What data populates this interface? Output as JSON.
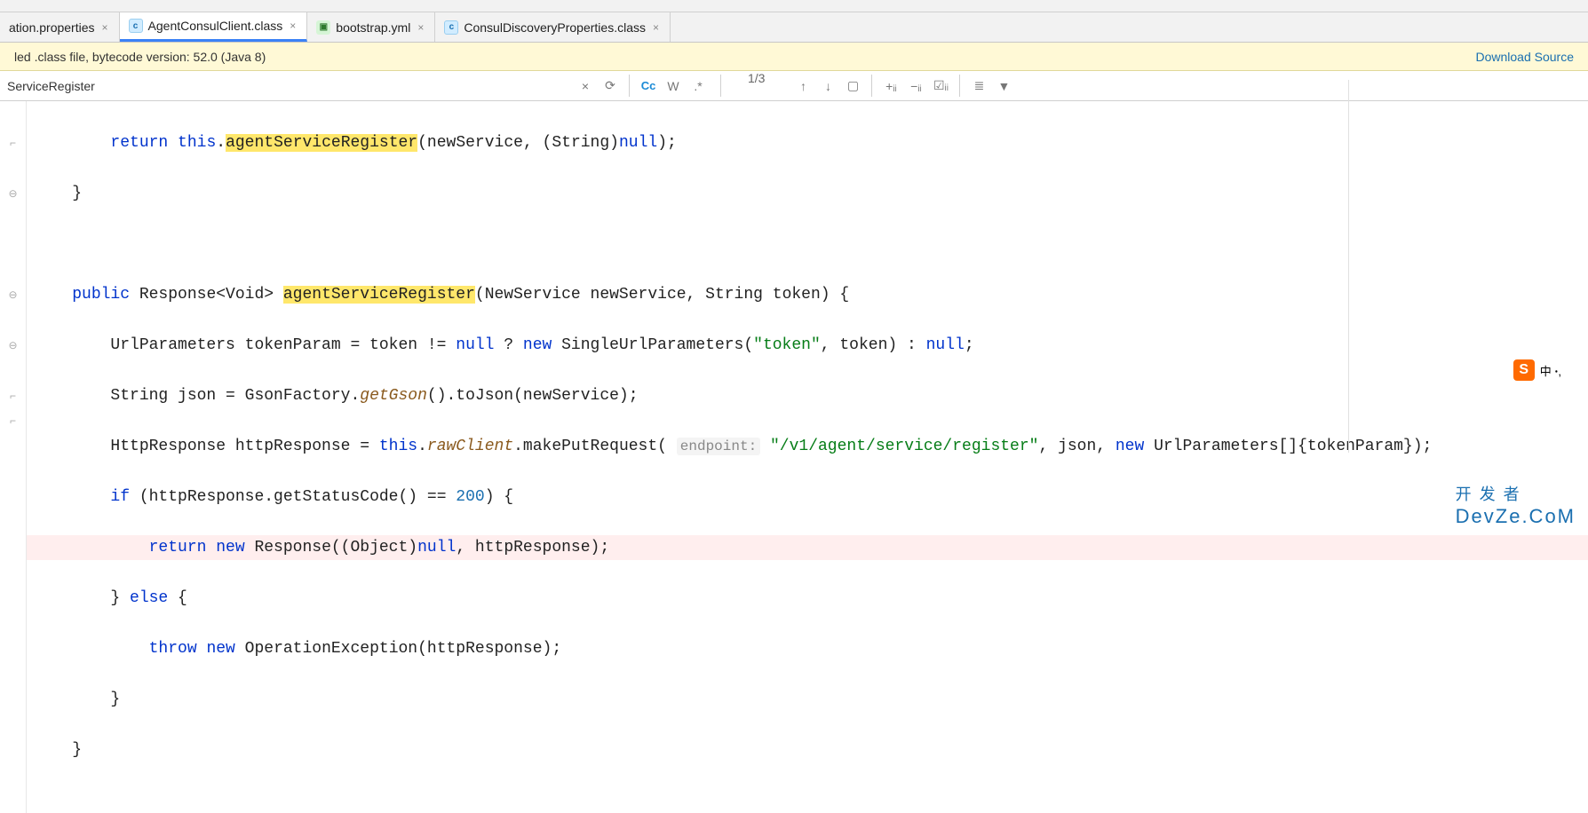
{
  "tabs": [
    {
      "label": "ation.properties",
      "icon": "prop"
    },
    {
      "label": "AgentConsulClient.class",
      "icon": "class",
      "active": true
    },
    {
      "label": "bootstrap.yml",
      "icon": "yml"
    },
    {
      "label": "ConsulDiscoveryProperties.class",
      "icon": "class"
    }
  ],
  "banner": {
    "text": "led .class file, bytecode version: 52.0 (Java 8)",
    "link": "Download Source"
  },
  "search": {
    "value": "ServiceRegister",
    "match_count": "1/3",
    "cc_label": "Cc",
    "w_label": "W"
  },
  "code": {
    "l1_return": "return",
    "l1_this": "this",
    "l1_method": "agentServiceRegister",
    "l1_rest": "(newService, (String)",
    "l1_null": "null",
    "l1_end": ");",
    "l3_public": "public",
    "l3_sig1": " Response<Void> ",
    "l3_method": "agentServiceRegister",
    "l3_sig2": "(NewService newService, String token) {",
    "l4_a": "        UrlParameters tokenParam = token != ",
    "l4_null1": "null",
    "l4_q": " ? ",
    "l4_new": "new",
    "l4_b": " SingleUrlParameters(",
    "l4_str": "\"token\"",
    "l4_c": ", token) : ",
    "l4_null2": "null",
    "l4_end": ";",
    "l5_a": "        String json = GsonFactory.",
    "l5_m": "getGson",
    "l5_b": "().toJson(newService);",
    "l6_a": "        HttpResponse httpResponse = ",
    "l6_this": "this",
    "l6_b": ".",
    "l6_raw": "rawClient",
    "l6_c": ".makePutRequest( ",
    "l6_hint": "endpoint:",
    "l6_sp": " ",
    "l6_str": "\"/v1/agent/service/register\"",
    "l6_d": ", json, ",
    "l6_new": "new",
    "l6_e": " UrlParameters[]{tokenParam});",
    "l7_if": "if",
    "l7_a": " (httpResponse.getStatusCode() == ",
    "l7_num": "200",
    "l7_b": ") {",
    "l8_return": "return",
    "l8_sp": " ",
    "l8_new": "new",
    "l8_a": " Response((Object)",
    "l8_null": "null",
    "l8_b": ", httpResponse);",
    "l9_a": "        } ",
    "l9_else": "else",
    "l9_b": " {",
    "l10_throw": "throw",
    "l10_sp": " ",
    "l10_new": "new",
    "l10_a": " OperationException(httpResponse);",
    "l11": "        }",
    "l12": "    }"
  },
  "sogou": {
    "icon": "S",
    "text": "中 ꞏ,"
  },
  "watermark": {
    "zh": "开 发 者",
    "en": "DevZe.CoM"
  }
}
